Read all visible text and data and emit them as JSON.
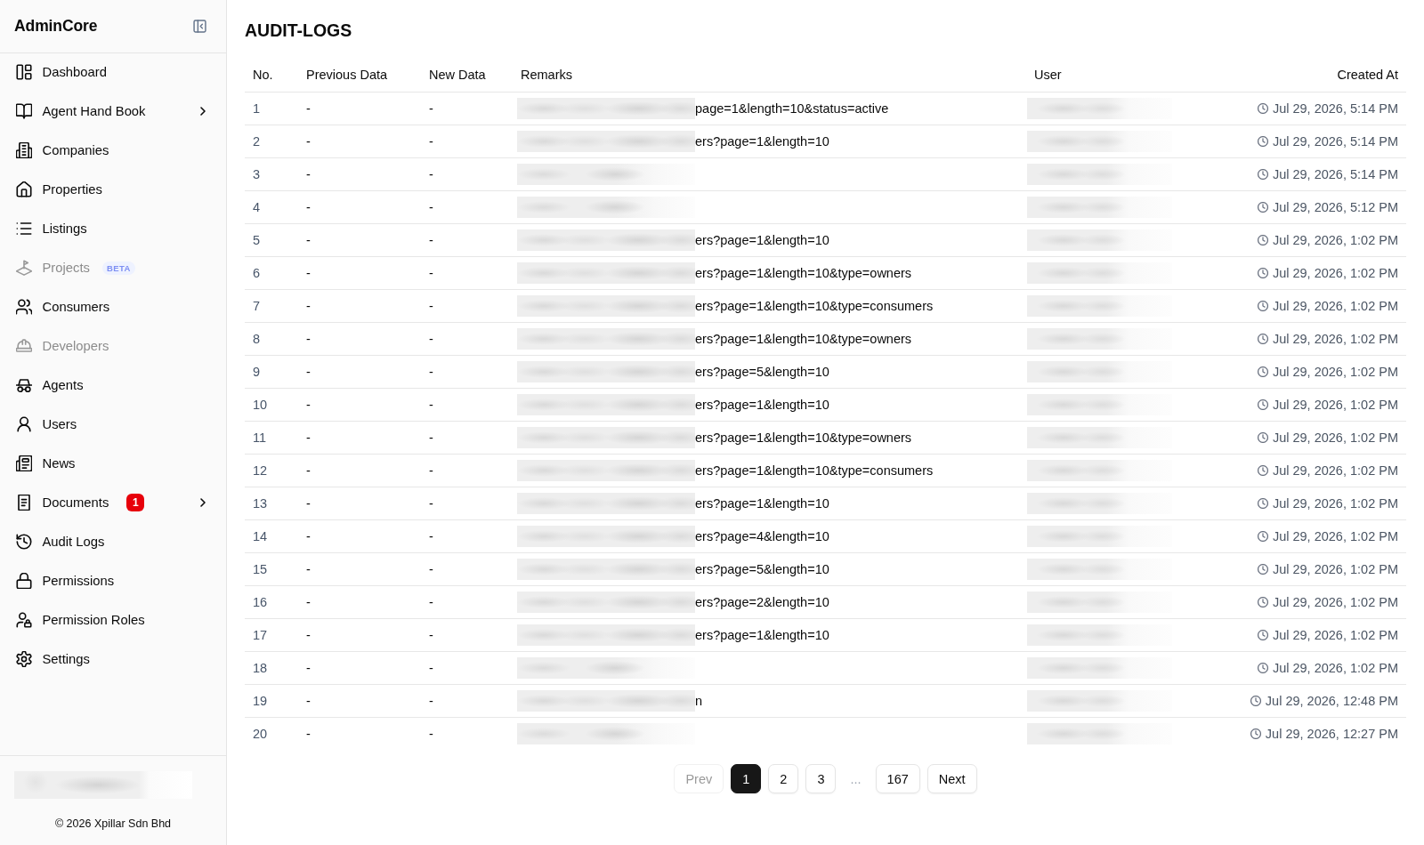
{
  "sidebar": {
    "brand": "AdminCore",
    "items": [
      {
        "label": "Dashboard",
        "disabled": false,
        "expandable": false
      },
      {
        "label": "Agent Hand Book",
        "disabled": false,
        "expandable": true
      },
      {
        "label": "Companies",
        "disabled": false,
        "expandable": false
      },
      {
        "label": "Properties",
        "disabled": false,
        "expandable": false
      },
      {
        "label": "Listings",
        "disabled": false,
        "expandable": false
      },
      {
        "label": "Projects",
        "disabled": true,
        "expandable": false,
        "badge": {
          "text": "BETA",
          "kind": "beta"
        }
      },
      {
        "label": "Consumers",
        "disabled": false,
        "expandable": false
      },
      {
        "label": "Developers",
        "disabled": true,
        "expandable": false
      },
      {
        "label": "Agents",
        "disabled": false,
        "expandable": false
      },
      {
        "label": "Users",
        "disabled": false,
        "expandable": false
      },
      {
        "label": "News",
        "disabled": false,
        "expandable": false
      },
      {
        "label": "Documents",
        "disabled": false,
        "expandable": true,
        "badge": {
          "text": "1",
          "kind": "count"
        }
      },
      {
        "label": "Audit Logs",
        "disabled": false,
        "expandable": false
      },
      {
        "label": "Permissions",
        "disabled": false,
        "expandable": false
      },
      {
        "label": "Permission Roles",
        "disabled": false,
        "expandable": false
      },
      {
        "label": "Settings",
        "disabled": false,
        "expandable": false
      }
    ],
    "profile": {
      "redacted": true
    },
    "copyright": "© 2026 Xpillar Sdn Bhd"
  },
  "page": {
    "title": "AUDIT-LOGS"
  },
  "table": {
    "columns": [
      "No.",
      "Previous Data",
      "New Data",
      "Remarks",
      "User",
      "Created At"
    ],
    "rows": [
      {
        "no": "1",
        "previous_data": "-",
        "new_data": "-",
        "remarks": "page=1&length=10&status=active",
        "created_at": "Jul 29, 2026, 5:14 PM"
      },
      {
        "no": "2",
        "previous_data": "-",
        "new_data": "-",
        "remarks": "ers?page=1&length=10",
        "created_at": "Jul 29, 2026, 5:14 PM"
      },
      {
        "no": "3",
        "previous_data": "-",
        "new_data": "-",
        "created_at": "Jul 29, 2026, 5:14 PM"
      },
      {
        "no": "4",
        "previous_data": "-",
        "new_data": "-",
        "created_at": "Jul 29, 2026, 5:12 PM"
      },
      {
        "no": "5",
        "previous_data": "-",
        "new_data": "-",
        "remarks": "ers?page=1&length=10",
        "created_at": "Jul 29, 2026, 1:02 PM"
      },
      {
        "no": "6",
        "previous_data": "-",
        "new_data": "-",
        "remarks": "ers?page=1&length=10&type=owners",
        "created_at": "Jul 29, 2026, 1:02 PM"
      },
      {
        "no": "7",
        "previous_data": "-",
        "new_data": "-",
        "remarks": "ers?page=1&length=10&type=consumers",
        "created_at": "Jul 29, 2026, 1:02 PM"
      },
      {
        "no": "8",
        "previous_data": "-",
        "new_data": "-",
        "remarks": "ers?page=1&length=10&type=owners",
        "created_at": "Jul 29, 2026, 1:02 PM"
      },
      {
        "no": "9",
        "previous_data": "-",
        "new_data": "-",
        "remarks": "ers?page=5&length=10",
        "created_at": "Jul 29, 2026, 1:02 PM"
      },
      {
        "no": "10",
        "previous_data": "-",
        "new_data": "-",
        "remarks": "ers?page=1&length=10",
        "created_at": "Jul 29, 2026, 1:02 PM"
      },
      {
        "no": "11",
        "previous_data": "-",
        "new_data": "-",
        "remarks": "ers?page=1&length=10&type=owners",
        "created_at": "Jul 29, 2026, 1:02 PM"
      },
      {
        "no": "12",
        "previous_data": "-",
        "new_data": "-",
        "remarks": "ers?page=1&length=10&type=consumers",
        "created_at": "Jul 29, 2026, 1:02 PM"
      },
      {
        "no": "13",
        "previous_data": "-",
        "new_data": "-",
        "remarks": "ers?page=1&length=10",
        "created_at": "Jul 29, 2026, 1:02 PM"
      },
      {
        "no": "14",
        "previous_data": "-",
        "new_data": "-",
        "remarks": "ers?page=4&length=10",
        "created_at": "Jul 29, 2026, 1:02 PM"
      },
      {
        "no": "15",
        "previous_data": "-",
        "new_data": "-",
        "remarks": "ers?page=5&length=10",
        "created_at": "Jul 29, 2026, 1:02 PM"
      },
      {
        "no": "16",
        "previous_data": "-",
        "new_data": "-",
        "remarks": "ers?page=2&length=10",
        "created_at": "Jul 29, 2026, 1:02 PM"
      },
      {
        "no": "17",
        "previous_data": "-",
        "new_data": "-",
        "remarks": "ers?page=1&length=10",
        "created_at": "Jul 29, 2026, 1:02 PM"
      },
      {
        "no": "18",
        "previous_data": "-",
        "new_data": "-",
        "created_at": "Jul 29, 2026, 1:02 PM"
      },
      {
        "no": "19",
        "previous_data": "-",
        "new_data": "-",
        "remarks": "n",
        "created_at": "Jul 29, 2026, 12:48 PM"
      },
      {
        "no": "20",
        "previous_data": "-",
        "new_data": "-",
        "created_at": "Jul 29, 2026, 12:27 PM"
      }
    ]
  },
  "pagination": {
    "prev": {
      "label": "Prev",
      "disabled": true
    },
    "pages": [
      {
        "label": "1",
        "kind": "page",
        "selected": true
      },
      {
        "label": "2",
        "kind": "page",
        "selected": false
      },
      {
        "label": "3",
        "kind": "page",
        "selected": false
      },
      {
        "label": "...",
        "kind": "ellipsis",
        "selected": false
      },
      {
        "label": "167",
        "kind": "page",
        "selected": false
      }
    ],
    "next": {
      "label": "Next",
      "disabled": false
    }
  }
}
